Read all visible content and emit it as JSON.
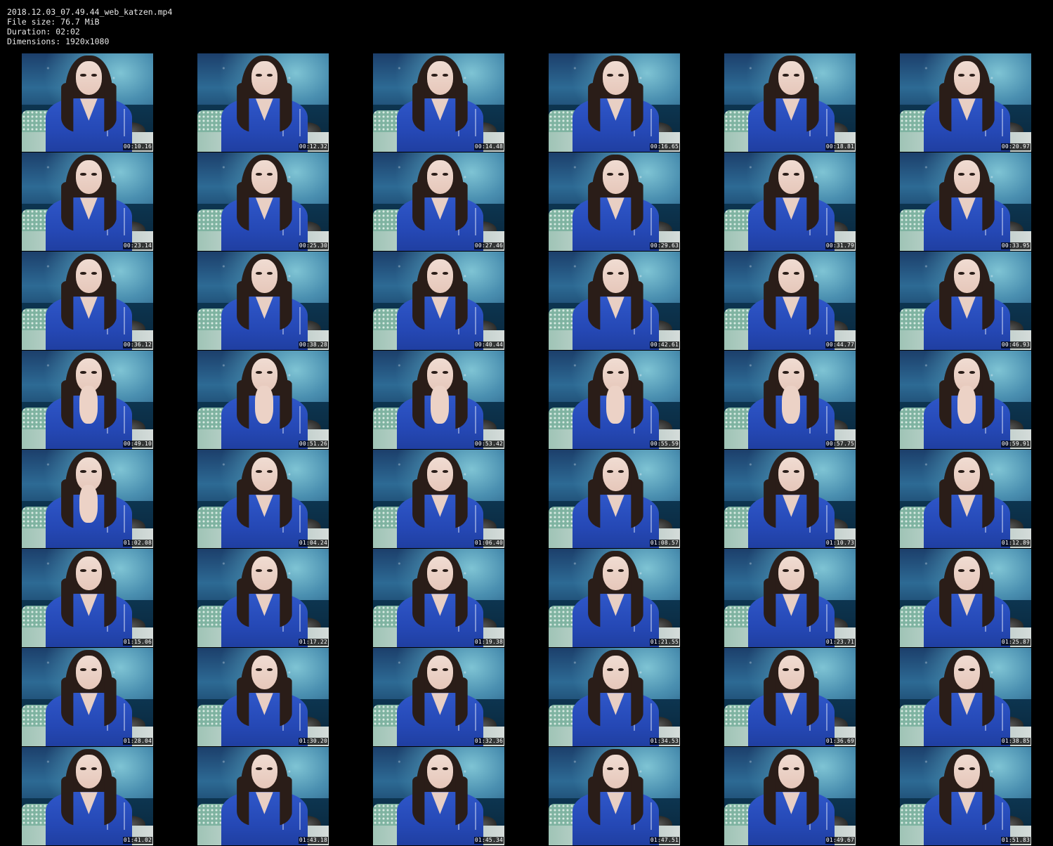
{
  "header": {
    "filename": "2018.12.03_07.49.44_web_katzen.mp4",
    "file_size": "File size: 76.7 MiB",
    "duration": "Duration: 02:02",
    "dimensions": "Dimensions: 1920x1080"
  },
  "thumbnails": [
    {
      "timestamp": "00:10.16"
    },
    {
      "timestamp": "00:12.32"
    },
    {
      "timestamp": "00:14.48"
    },
    {
      "timestamp": "00:16.65"
    },
    {
      "timestamp": "00:18.81"
    },
    {
      "timestamp": "00:20.97"
    },
    {
      "timestamp": "00:23.14"
    },
    {
      "timestamp": "00:25.30"
    },
    {
      "timestamp": "00:27.46"
    },
    {
      "timestamp": "00:29.63"
    },
    {
      "timestamp": "00:31.79"
    },
    {
      "timestamp": "00:33.95"
    },
    {
      "timestamp": "00:36.12"
    },
    {
      "timestamp": "00:38.28"
    },
    {
      "timestamp": "00:40.44"
    },
    {
      "timestamp": "00:42.61"
    },
    {
      "timestamp": "00:44.77"
    },
    {
      "timestamp": "00:46.93"
    },
    {
      "timestamp": "00:49.10",
      "pose": "hand"
    },
    {
      "timestamp": "00:51.26",
      "pose": "hand"
    },
    {
      "timestamp": "00:53.42",
      "pose": "hand"
    },
    {
      "timestamp": "00:55.59",
      "pose": "hand"
    },
    {
      "timestamp": "00:57.75",
      "pose": "hand"
    },
    {
      "timestamp": "00:59.91",
      "pose": "hand"
    },
    {
      "timestamp": "01:02.08",
      "pose": "hand"
    },
    {
      "timestamp": "01:04.24"
    },
    {
      "timestamp": "01:06.40"
    },
    {
      "timestamp": "01:08.57"
    },
    {
      "timestamp": "01:10.73"
    },
    {
      "timestamp": "01:12.89"
    },
    {
      "timestamp": "01:15.06"
    },
    {
      "timestamp": "01:17.22"
    },
    {
      "timestamp": "01:19.38"
    },
    {
      "timestamp": "01:21.55"
    },
    {
      "timestamp": "01:23.71"
    },
    {
      "timestamp": "01:25.87"
    },
    {
      "timestamp": "01:28.04"
    },
    {
      "timestamp": "01:30.20"
    },
    {
      "timestamp": "01:32.36"
    },
    {
      "timestamp": "01:34.53"
    },
    {
      "timestamp": "01:36.69"
    },
    {
      "timestamp": "01:38.85"
    },
    {
      "timestamp": "01:41.02"
    },
    {
      "timestamp": "01:43.18"
    },
    {
      "timestamp": "01:45.34"
    },
    {
      "timestamp": "01:47.51"
    },
    {
      "timestamp": "01:49.67"
    },
    {
      "timestamp": "01:51.83"
    }
  ]
}
